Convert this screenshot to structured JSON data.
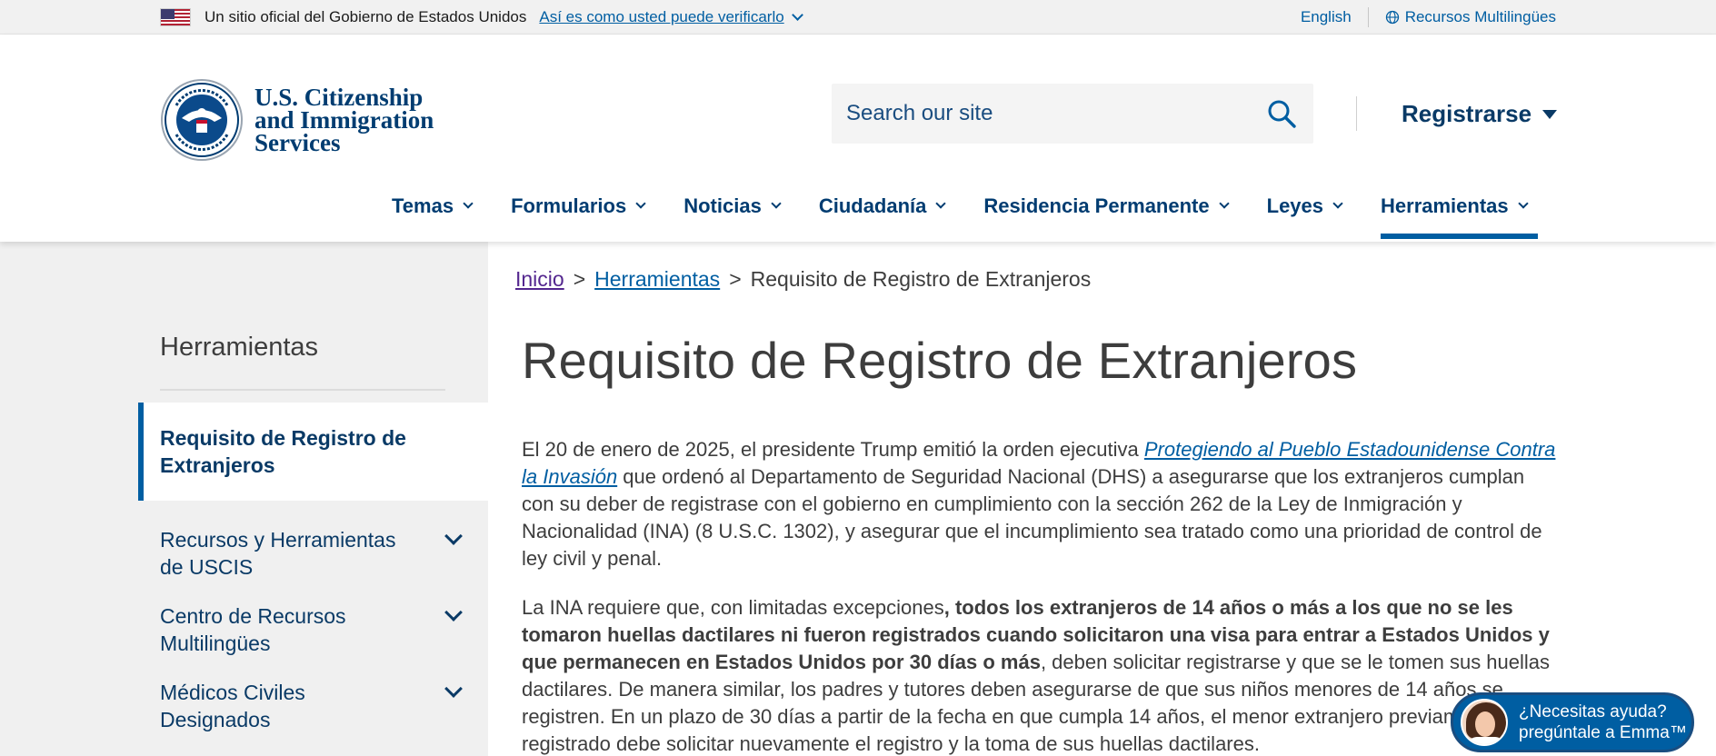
{
  "banner": {
    "official_text": "Un sitio oficial del Gobierno de Estados Unidos",
    "verify_link": "Así es como usted puede verificarlo",
    "lang_english": "English",
    "lang_multilingual": "Recursos Multilingües"
  },
  "header": {
    "logo_line1": "U.S. Citizenship",
    "logo_line2": "and Immigration",
    "logo_line3": "Services",
    "search_placeholder": "Search our site",
    "register_label": "Registrarse"
  },
  "nav": {
    "items": [
      {
        "label": "Temas"
      },
      {
        "label": "Formularios"
      },
      {
        "label": "Noticias"
      },
      {
        "label": "Ciudadanía"
      },
      {
        "label": "Residencia Permanente"
      },
      {
        "label": "Leyes"
      },
      {
        "label": "Herramientas"
      }
    ]
  },
  "sidebar": {
    "title": "Herramientas",
    "active_item": "Requisito de Registro de Extranjeros",
    "items": [
      {
        "label": "Recursos y Herramientas de USCIS"
      },
      {
        "label": "Centro de Recursos Multilingües"
      },
      {
        "label": "Médicos Civiles Designados"
      }
    ]
  },
  "breadcrumb": {
    "home": "Inicio",
    "section": "Herramientas",
    "current": "Requisito de Registro de Extranjeros",
    "separator": ">"
  },
  "main": {
    "title": "Requisito de Registro de Extranjeros",
    "p1_a": "El 20 de enero de 2025, el presidente Trump emitió la orden ejecutiva ",
    "p1_link": "Protegiendo al Pueblo Estadounidense Contra la Invasión",
    "p1_b": " que ordenó al Departamento de Seguridad Nacional (DHS) a asegurarse que los extranjeros cumplan con su deber de registrase con el gobierno en cumplimiento con la sección 262 de la Ley de Inmigración y Nacionalidad (INA) (8 U.S.C. 1302), y asegurar que el incumplimiento sea tratado como una prioridad de control de ley civil y penal.",
    "p2_a": "La INA requiere que, con limitadas excepciones",
    "p2_bold": ", todos los extranjeros de 14 años o más a los que no se les tomaron huellas dactilares ni fueron registrados cuando solicitaron una visa para entrar a Estados Unidos y que permanecen en Estados Unidos por 30 días o más",
    "p2_b": ", deben solicitar registrarse y que se le tomen sus huellas dactilares. De manera similar, los padres y tutores deben asegurarse de que sus niños menores de 14 años se registren. En un plazo de 30 días a partir de la fecha en que cumpla 14 años, el menor extranjero previamente registrado debe solicitar nuevamente el registro y la toma de sus huellas dactilares."
  },
  "chat": {
    "line1": "¿Necesitas ayuda?",
    "line2": "pregúntale a Emma™"
  }
}
